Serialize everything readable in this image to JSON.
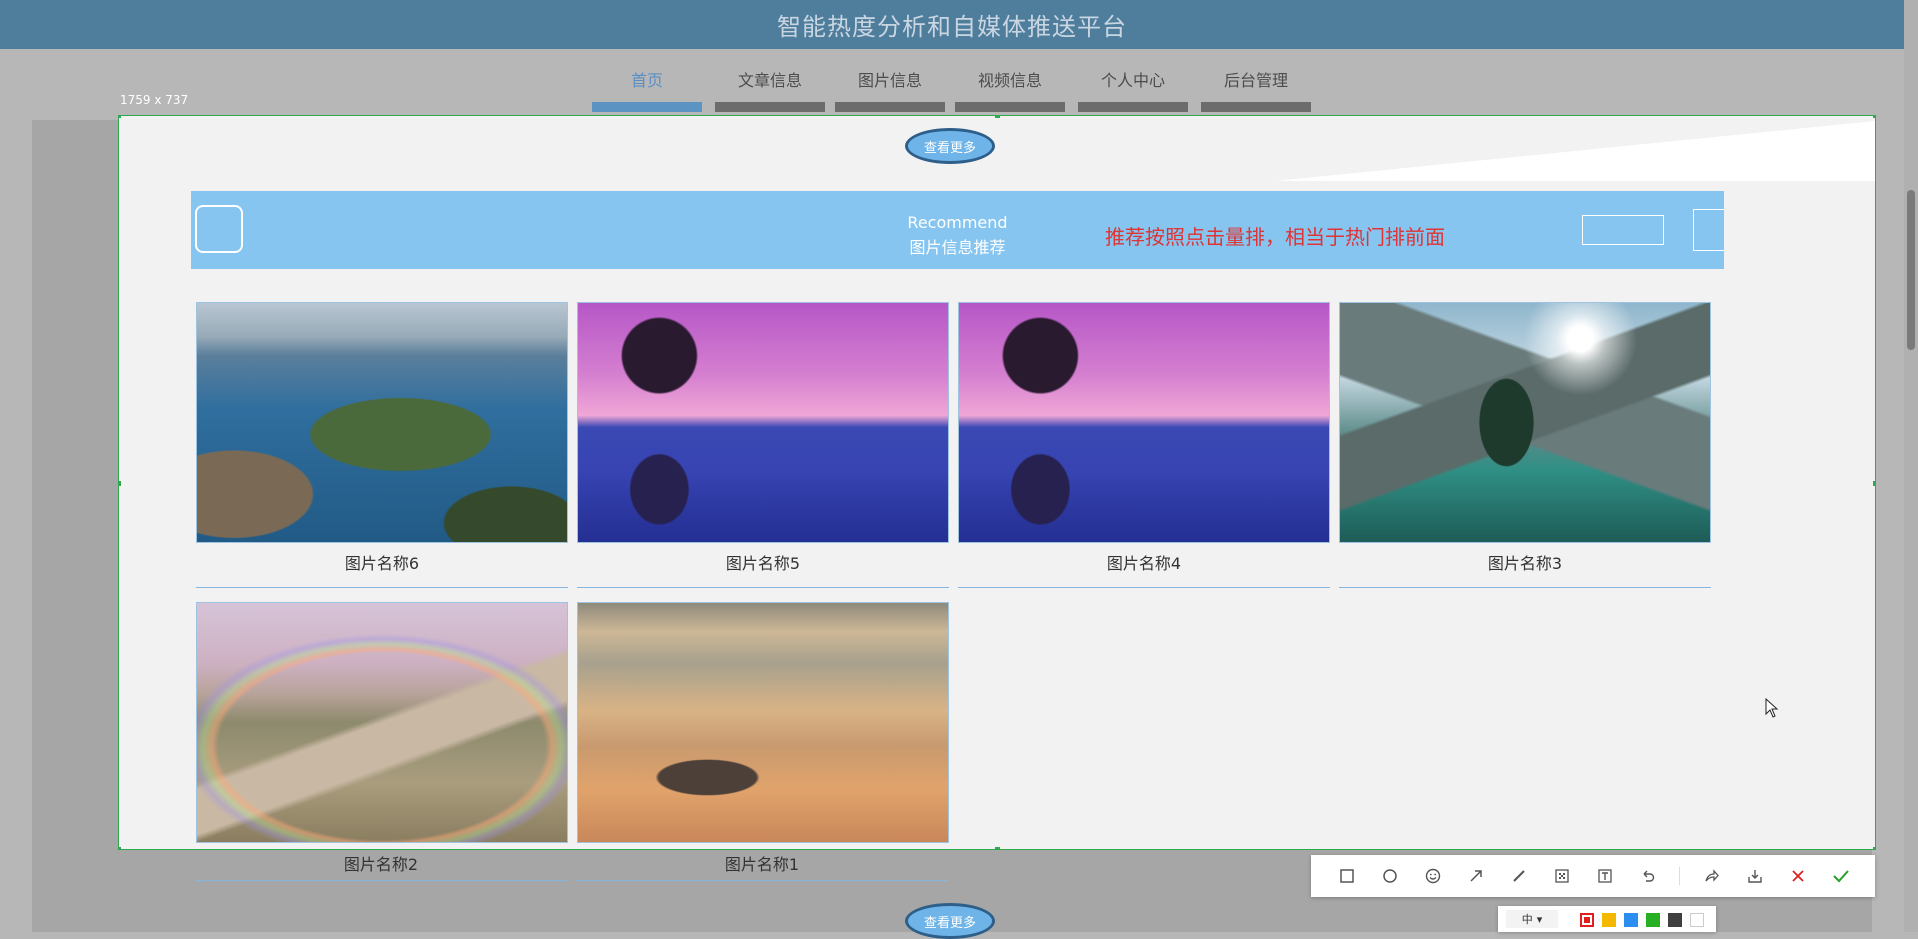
{
  "header": {
    "title": "智能热度分析和自媒体推送平台"
  },
  "nav": {
    "items": [
      {
        "label": "首页",
        "active": true
      },
      {
        "label": "文章信息",
        "active": false
      },
      {
        "label": "图片信息",
        "active": false
      },
      {
        "label": "视频信息",
        "active": false
      },
      {
        "label": "个人中心",
        "active": false
      },
      {
        "label": "后台管理",
        "active": false
      }
    ]
  },
  "selection": {
    "size_label": "1759 x 737"
  },
  "section": {
    "more_label_top": "查看更多",
    "more_label_bottom": "查看更多",
    "banner_en": "Recommend",
    "banner_zh": "图片信息推荐",
    "note": "推荐按照点击量排，相当于热门排前面"
  },
  "cards": [
    {
      "caption": "图片名称6",
      "image": "lake-island"
    },
    {
      "caption": "图片名称5",
      "image": "palm-sunset-pool"
    },
    {
      "caption": "图片名称4",
      "image": "palm-sunset-pool"
    },
    {
      "caption": "图片名称3",
      "image": "mountain-lake"
    },
    {
      "caption": "图片名称2",
      "image": "rainbow-flower-path"
    },
    {
      "caption": "图片名称1",
      "image": "sunset-clouds"
    }
  ],
  "toolbar": {
    "tools": [
      "rectangle-icon",
      "ellipse-icon",
      "emoji-icon",
      "arrow-icon",
      "pen-icon",
      "mosaic-icon",
      "text-icon",
      "undo-icon",
      "share-icon",
      "download-icon",
      "cancel-icon",
      "confirm-icon"
    ],
    "size_option": "中",
    "colors": [
      "#e02020",
      "#f5b800",
      "#2b8ef0",
      "#27b023",
      "#404040",
      "#ffffff"
    ]
  }
}
